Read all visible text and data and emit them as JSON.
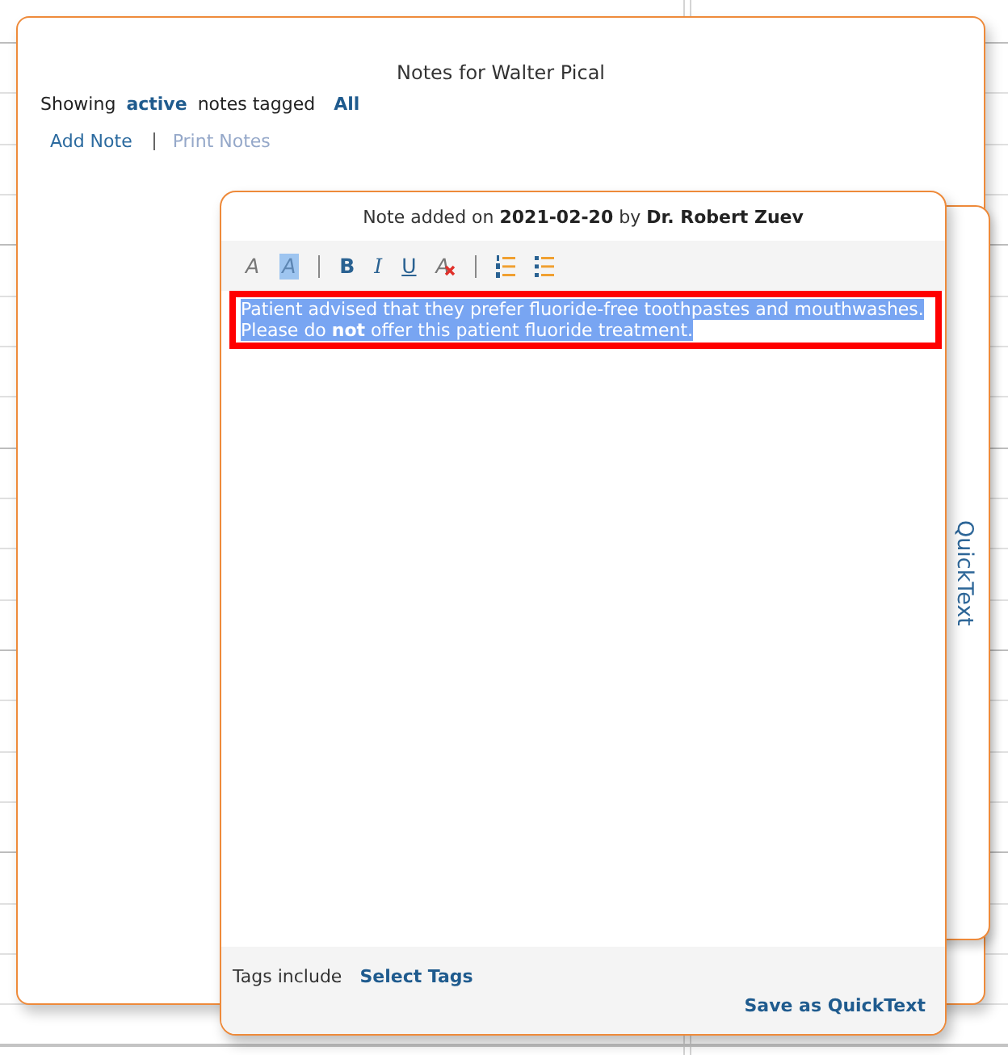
{
  "notes_panel": {
    "title": "Notes for Walter Pical",
    "filter": {
      "prefix": "Showing",
      "status": "active",
      "middle": "notes tagged",
      "tag": "All"
    },
    "actions": [
      {
        "label": "Add Note",
        "disabled": false
      },
      {
        "label": "Print Notes",
        "disabled": true
      }
    ]
  },
  "quicktext_tab": {
    "label": "QuickText"
  },
  "note_editor": {
    "header": "Note added on **2021-02-20** by **Dr. Robert Zuev**",
    "toolbar": [
      {
        "kind": "text-color",
        "glyph": "A"
      },
      {
        "kind": "highlight",
        "glyph": "A"
      },
      {
        "kind": "separator"
      },
      {
        "kind": "bold",
        "glyph": "B"
      },
      {
        "kind": "italic",
        "glyph": "I"
      },
      {
        "kind": "underline",
        "glyph": "U"
      },
      {
        "kind": "clear-format",
        "glyph": "A"
      },
      {
        "kind": "separator"
      },
      {
        "kind": "numbered-list"
      },
      {
        "kind": "bulleted-list"
      }
    ],
    "body": {
      "lines": [
        "Patient advised that they prefer fluoride-free toothpastes and mouthwashes.",
        "Please do **not** offer this patient fluoride treatment."
      ],
      "selected": true,
      "outlined": true
    },
    "footer": {
      "tags_label": "Tags include",
      "tags_link": "Select Tags",
      "save_link": "Save as QuickText"
    }
  }
}
